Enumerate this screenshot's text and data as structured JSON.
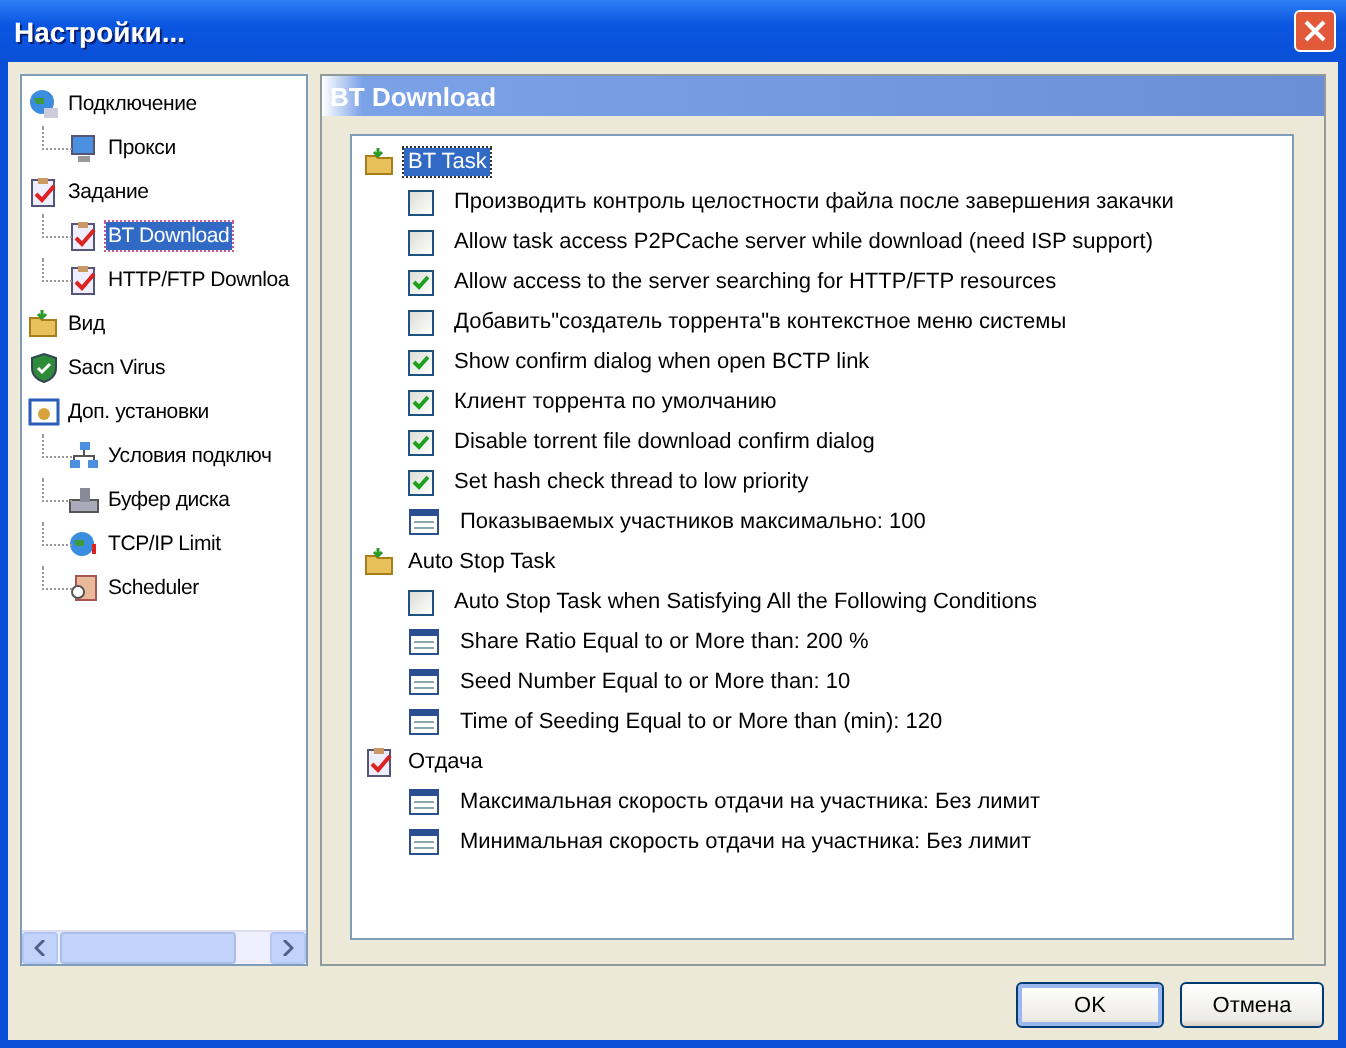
{
  "window": {
    "title": "Настройки..."
  },
  "sidebar": {
    "items": [
      {
        "label": "Подключение",
        "selected": false,
        "children": [
          {
            "label": "Прокси",
            "selected": false
          }
        ]
      },
      {
        "label": "Задание",
        "selected": false,
        "children": [
          {
            "label": "BT Download",
            "selected": true
          },
          {
            "label": "HTTP/FTP Downloa",
            "selected": false
          }
        ]
      },
      {
        "label": "Вид",
        "selected": false
      },
      {
        "label": "Sacn Virus",
        "selected": false
      },
      {
        "label": "Доп. установки",
        "selected": false,
        "children": [
          {
            "label": "Условия подключ",
            "selected": false
          },
          {
            "label": "Буфер диска",
            "selected": false
          },
          {
            "label": "TCP/IP Limit",
            "selected": false
          },
          {
            "label": "Scheduler",
            "selected": false
          }
        ]
      }
    ]
  },
  "panel": {
    "title": "BT Download",
    "groups": [
      {
        "label": "BT Task",
        "selected": true,
        "items": [
          {
            "kind": "checkbox",
            "label": "Производить контроль целостности файла после завершения закачки",
            "checked": false
          },
          {
            "kind": "checkbox",
            "label": "Allow task access P2PCache server while download (need ISP support)",
            "checked": false
          },
          {
            "kind": "checkbox",
            "label": "Allow access to the server searching for HTTP/FTP resources",
            "checked": true
          },
          {
            "kind": "checkbox",
            "label": "Добавить\"создатель торрента\"в контекстное меню системы",
            "checked": false
          },
          {
            "kind": "checkbox",
            "label": "Show confirm dialog when open BCTP link",
            "checked": true
          },
          {
            "kind": "checkbox",
            "label": "Клиент торрента по умолчанию",
            "checked": true
          },
          {
            "kind": "checkbox",
            "label": "Disable torrent file download confirm dialog",
            "checked": true
          },
          {
            "kind": "checkbox",
            "label": "Set hash check thread to low priority",
            "checked": true
          },
          {
            "kind": "value",
            "label": "Показываемых участников максимально: 100"
          }
        ]
      },
      {
        "label": "Auto Stop Task",
        "selected": false,
        "items": [
          {
            "kind": "checkbox",
            "label": "Auto Stop Task when Satisfying All the Following Conditions",
            "checked": false
          },
          {
            "kind": "value",
            "label": "Share Ratio Equal to or More than: 200 %"
          },
          {
            "kind": "value",
            "label": "Seed Number Equal to or More than: 10"
          },
          {
            "kind": "value",
            "label": "Time of Seeding Equal to or More than (min): 120"
          }
        ]
      },
      {
        "label": "Отдача",
        "selected": false,
        "items": [
          {
            "kind": "value",
            "label": "Максимальная скорость отдачи на участника: Без лимит"
          },
          {
            "kind": "value",
            "label": "Минимальная скорость отдачи на участника: Без лимит"
          }
        ]
      }
    ]
  },
  "buttons": [
    {
      "label": "OK",
      "default": true
    },
    {
      "label": "Отмена",
      "default": false
    }
  ]
}
